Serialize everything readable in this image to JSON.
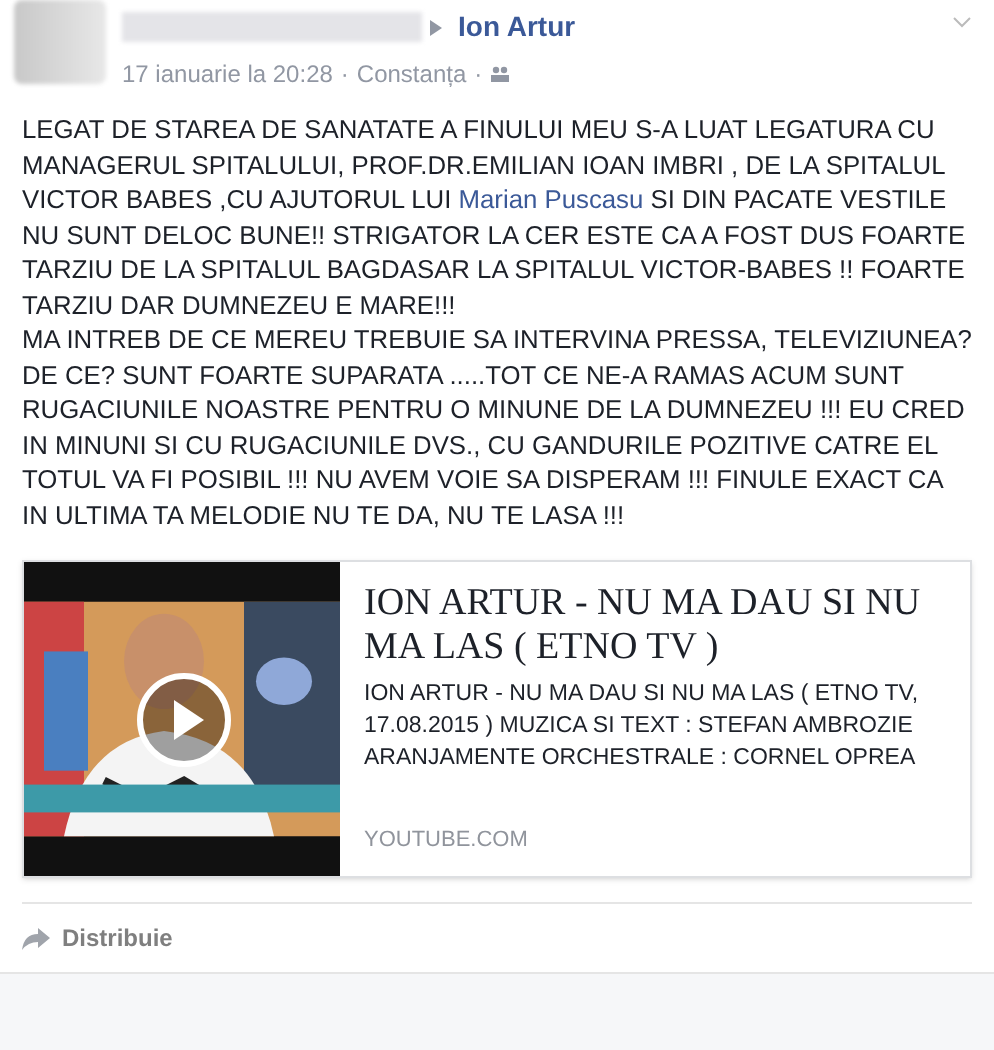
{
  "post": {
    "author": "Ion Artur",
    "timestamp": "17 ianuarie la 20:28",
    "location": "Constanța",
    "separator": "·",
    "paragraphs": [
      {
        "parts": [
          {
            "kind": "text",
            "text": "LEGAT DE STAREA DE SANATATE A FINULUI MEU S-A LUAT LEGATURA CU MANAGERUL SPITALULUI, PROF.DR.EMILIAN IOAN IMBRI , DE LA SPITALUL VICTOR BABES ,CU AJUTORUL LUI "
          },
          {
            "kind": "link",
            "text": "Marian Puscasu"
          },
          {
            "kind": "text",
            "text": " SI DIN PACATE VESTILE NU SUNT DELOC BUNE!! STRIGATOR LA CER ESTE CA A FOST DUS FOARTE TARZIU DE LA SPITALUL BAGDASAR LA SPITALUL VICTOR-BABES !! FOARTE TARZIU DAR DUMNEZEU E MARE!!!"
          }
        ]
      },
      {
        "parts": [
          {
            "kind": "text",
            "text": "MA INTREB DE CE MEREU TREBUIE SA INTERVINA PRESSA, TELEVIZIUNEA? DE CE? SUNT FOARTE SUPARATA .....TOT CE NE-A RAMAS ACUM SUNT RUGACIUNILE NOASTRE PENTRU O MINUNE DE LA DUMNEZEU !!! EU CRED IN MINUNI SI CU RUGACIUNILE DVS., CU GANDURILE POZITIVE CATRE EL TOTUL VA FI POSIBIL !!! NU AVEM VOIE SA DISPERAM !!! FINULE EXACT CA IN ULTIMA TA MELODIE NU TE DA, NU TE LASA !!!"
          }
        ]
      }
    ],
    "link_card": {
      "title": "ION ARTUR - NU MA DAU SI NU MA LAS ( ETNO TV )",
      "description": "ION ARTUR - NU MA DAU SI NU MA LAS ( ETNO TV, 17.08.2015 ) MUZICA SI TEXT : STEFAN AMBROZIE ARANJAMENTE ORCHESTRALE : CORNEL OPREA",
      "domain": "YOUTUBE.COM"
    },
    "actions": [
      "Distribuie"
    ]
  }
}
